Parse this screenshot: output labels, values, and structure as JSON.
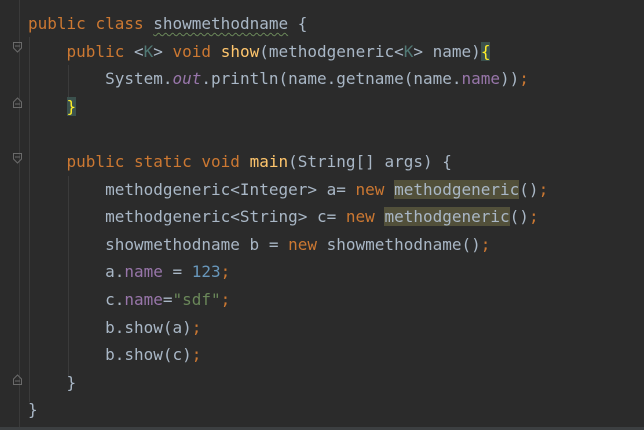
{
  "colors": {
    "background": "#2b2b2b",
    "keyword": "#cc7832",
    "method": "#ffc66d",
    "type_param": "#507874",
    "field": "#9876aa",
    "number": "#6897bb",
    "string": "#6a8759",
    "plain": "#a9b7c6"
  },
  "code": {
    "l1": {
      "kw1": "public",
      "kw2": "class",
      "cls": "showmethodname",
      "rest": " {"
    },
    "l2": {
      "kw1": "public",
      "lt": "<",
      "tp": "K",
      "gt": ">",
      "kw2": "void",
      "fn": "show",
      "p1": "(methodgeneric<",
      "tp2": "K",
      "p2": "> name)",
      "brace": "{"
    },
    "l3": {
      "sys": "System.",
      "out": "out",
      "rest1": ".println(name.getname(name.",
      "fld": "name",
      "rest2": "))",
      "semi": ";"
    },
    "l4": {
      "brace": "}"
    },
    "l6": {
      "kw1": "public",
      "kw2": "static",
      "kw3": "void",
      "fn": "main",
      "rest": "(String[] args) {"
    },
    "l7": {
      "pre": "methodgeneric<Integer> a= ",
      "kw": "new",
      "hl": "methodgeneric",
      "rest": "()",
      "semi": ";"
    },
    "l8": {
      "pre": "methodgeneric<String> c= ",
      "kw": "new",
      "hl": "methodgeneric",
      "rest": "()",
      "semi": ";"
    },
    "l9": {
      "pre": "showmethodname b = ",
      "kw": "new",
      "rest": " showmethodname()",
      "semi": ";"
    },
    "l10": {
      "pre": "a.",
      "fld": "name",
      "eq": " = ",
      "num": "123",
      "semi": ";"
    },
    "l11": {
      "pre": "c.",
      "fld": "name",
      "eq": "=",
      "str": "\"sdf\"",
      "semi": ";"
    },
    "l12": {
      "rest": "b.show(a)",
      "semi": ";"
    },
    "l13": {
      "rest": "b.show(c)",
      "semi": ";"
    },
    "l14": {
      "brace": "}"
    },
    "l15": {
      "brace": "}"
    }
  }
}
